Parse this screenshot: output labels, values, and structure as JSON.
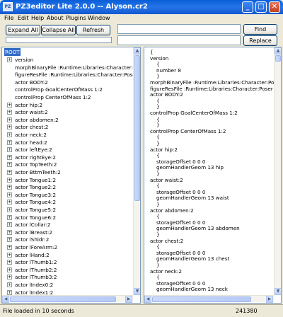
{
  "window": {
    "title": "PZ3editor Lite 2.0.0 -- Alyson.cr2",
    "icon": "app-icon",
    "minimize_glyph": "_",
    "maximize_glyph": "□",
    "close_glyph": "✕"
  },
  "menu": [
    "File",
    "Edit",
    "Help",
    "About",
    "Plugins",
    "Window"
  ],
  "toolbar": {
    "expand_all": "Expand All",
    "collapse_all": "Collapse All",
    "refresh": "Refresh",
    "find": "Find",
    "replace_with": "Replace With",
    "find_value": "",
    "replace_value": ""
  },
  "tree": {
    "root": "ROOT",
    "items": [
      {
        "label": "version",
        "expander": "+"
      },
      {
        "label": "morphBinaryFile :Runtime:Libraries:Character:Poser 8",
        "expander": ""
      },
      {
        "label": "figureResFile :Runtime:Libraries:Character:Poser 8:A",
        "expander": ""
      },
      {
        "label": "actor BODY:2",
        "expander": ""
      },
      {
        "label": "controlProp GoalCenterOfMass 1:2",
        "expander": ""
      },
      {
        "label": "controlProp CenterOfMass 1:2",
        "expander": ""
      },
      {
        "label": "actor hip:2",
        "expander": "+"
      },
      {
        "label": "actor waist:2",
        "expander": "+"
      },
      {
        "label": "actor abdomen:2",
        "expander": "+"
      },
      {
        "label": "actor chest:2",
        "expander": "+"
      },
      {
        "label": "actor neck:2",
        "expander": "+"
      },
      {
        "label": "actor head:2",
        "expander": "+"
      },
      {
        "label": "actor leftEye:2",
        "expander": "+"
      },
      {
        "label": "actor rightEye:2",
        "expander": "+"
      },
      {
        "label": "actor TopTeeth:2",
        "expander": "+"
      },
      {
        "label": "actor BttmTeeth:2",
        "expander": "+"
      },
      {
        "label": "actor Tongue1:2",
        "expander": "+"
      },
      {
        "label": "actor Tongue2:2",
        "expander": "+"
      },
      {
        "label": "actor Tongue3:2",
        "expander": "+"
      },
      {
        "label": "actor Tongue4:2",
        "expander": "+"
      },
      {
        "label": "actor Tongue5:2",
        "expander": "+"
      },
      {
        "label": "actor Tongue6:2",
        "expander": "+"
      },
      {
        "label": "actor lCollar:2",
        "expander": "+"
      },
      {
        "label": "actor lBreast:2",
        "expander": "+"
      },
      {
        "label": "actor lShldr:2",
        "expander": "+"
      },
      {
        "label": "actor lForeArm:2",
        "expander": "+"
      },
      {
        "label": "actor lHand:2",
        "expander": "+"
      },
      {
        "label": "actor lThumb1:2",
        "expander": "+"
      },
      {
        "label": "actor lThumb2:2",
        "expander": "+"
      },
      {
        "label": "actor lThumb3:2",
        "expander": "+"
      },
      {
        "label": "actor lIndex0:2",
        "expander": "+"
      },
      {
        "label": "actor lIndex1:2",
        "expander": "+"
      }
    ]
  },
  "code": {
    "lines": [
      {
        "text": "{",
        "indent": 0
      },
      {
        "text": "version",
        "indent": 0
      },
      {
        "text": "{",
        "indent": 1
      },
      {
        "text": "number 8",
        "indent": 1
      },
      {
        "text": "}",
        "indent": 1
      },
      {
        "text": "morphBinaryFile :Runtime:Libraries:Character:Poser 8",
        "indent": 0
      },
      {
        "text": "figureResFile :Runtime:Libraries:Character:Poser 8:Al",
        "indent": 0
      },
      {
        "text": "actor BODY:2",
        "indent": 0
      },
      {
        "text": "{",
        "indent": 1
      },
      {
        "text": "}",
        "indent": 1
      },
      {
        "text": "controlProp GoalCenterOfMass 1:2",
        "indent": 0
      },
      {
        "text": "{",
        "indent": 1
      },
      {
        "text": "}",
        "indent": 1
      },
      {
        "text": "controlProp CenterOfMass 1:2",
        "indent": 0
      },
      {
        "text": "{",
        "indent": 1
      },
      {
        "text": "}",
        "indent": 1
      },
      {
        "text": "actor hip:2",
        "indent": 0
      },
      {
        "text": "{",
        "indent": 1
      },
      {
        "text": "storageOffset 0 0 0",
        "indent": 1
      },
      {
        "text": "geomHandlerGeom 13 hip",
        "indent": 1
      },
      {
        "text": "}",
        "indent": 1
      },
      {
        "text": "actor waist:2",
        "indent": 0
      },
      {
        "text": "{",
        "indent": 1
      },
      {
        "text": "storageOffset 0 0 0",
        "indent": 1
      },
      {
        "text": "geomHandlerGeom 13 waist",
        "indent": 1
      },
      {
        "text": "}",
        "indent": 1
      },
      {
        "text": "actor abdomen:2",
        "indent": 0
      },
      {
        "text": "{",
        "indent": 1
      },
      {
        "text": "storageOffset 0 0 0",
        "indent": 1
      },
      {
        "text": "geomHandlerGeom 13 abdomen",
        "indent": 1
      },
      {
        "text": "}",
        "indent": 1
      },
      {
        "text": "actor chest:2",
        "indent": 0
      },
      {
        "text": "{",
        "indent": 1
      },
      {
        "text": "storageOffset 0 0 0",
        "indent": 1
      },
      {
        "text": "geomHandlerGeom 13 chest",
        "indent": 1
      },
      {
        "text": "}",
        "indent": 1
      },
      {
        "text": "actor neck:2",
        "indent": 0
      },
      {
        "text": "{",
        "indent": 1
      },
      {
        "text": "storageOffset 0 0 0",
        "indent": 1
      },
      {
        "text": "geomHandlerGeom 13 neck",
        "indent": 1
      }
    ]
  },
  "status": {
    "message": "File loaded in 10 seconds",
    "count": "241380"
  },
  "scroll": {
    "up": "▲",
    "down": "▼",
    "left": "◀",
    "right": "▶"
  }
}
